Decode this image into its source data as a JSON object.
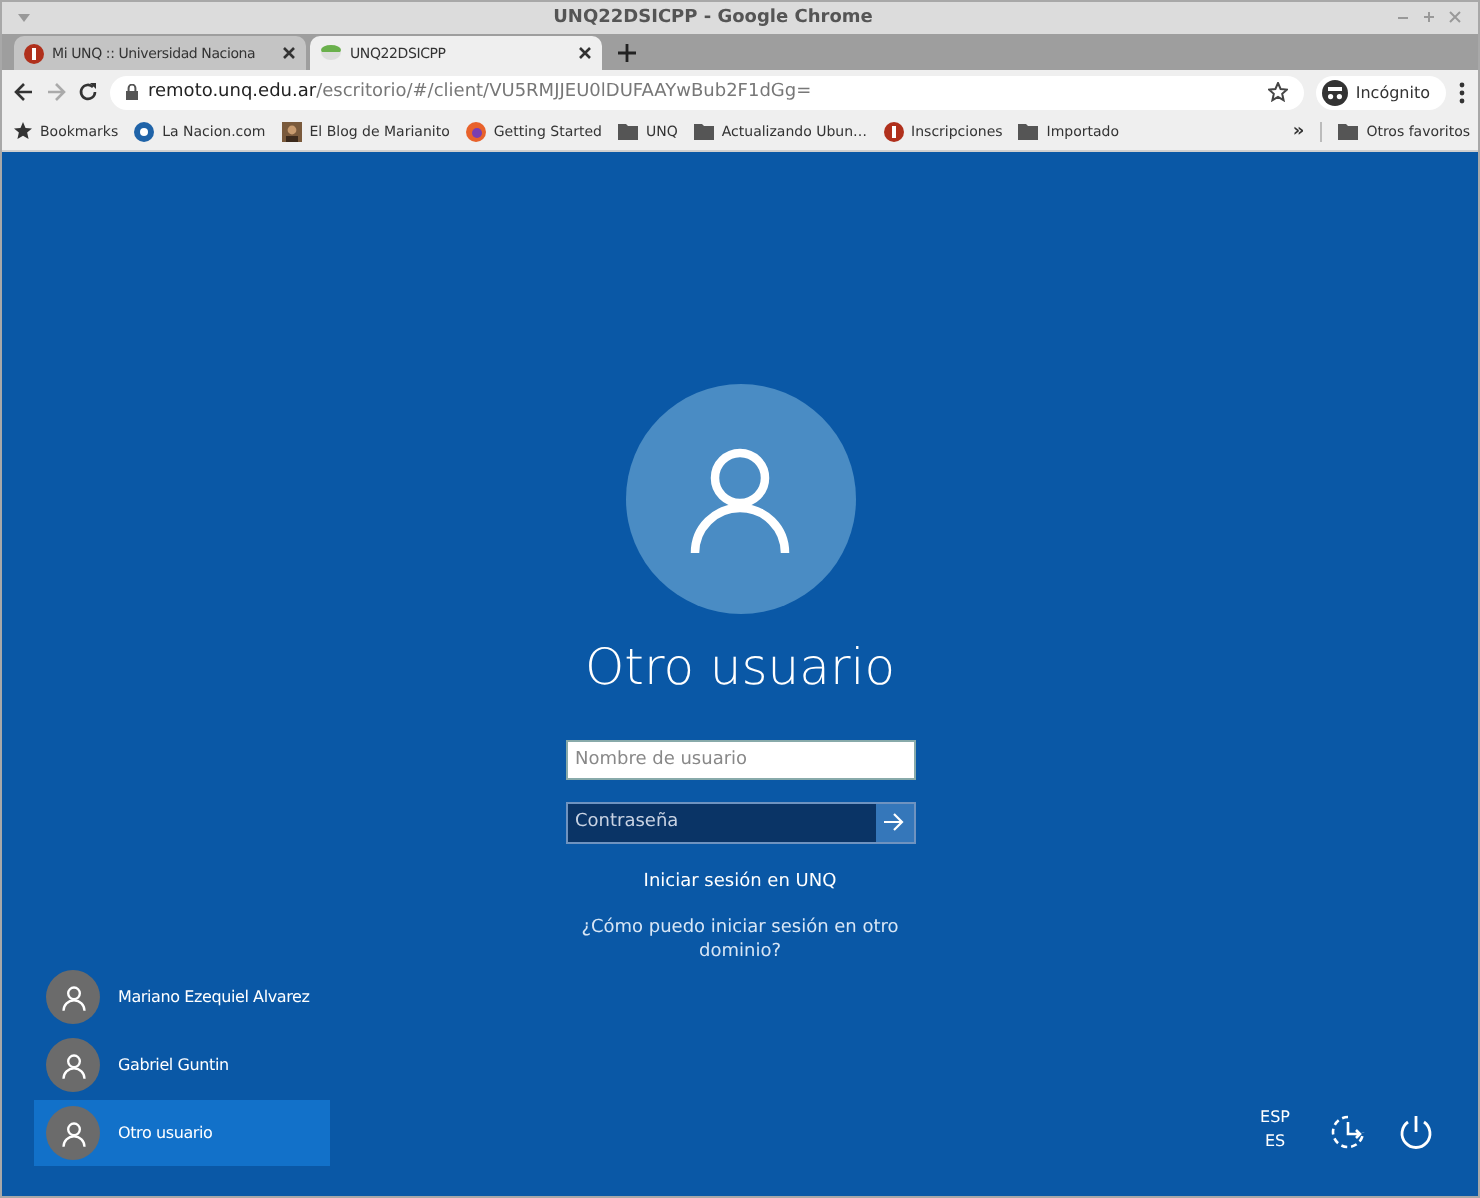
{
  "window": {
    "title": "UNQ22DSICPP - Google Chrome"
  },
  "tabs": [
    {
      "title": "Mi UNQ :: Universidad Naciona",
      "kind": "unq",
      "selected": false
    },
    {
      "title": "UNQ22DSICPP",
      "kind": "remote",
      "selected": true
    }
  ],
  "address_bar": {
    "domain": "remoto.unq.edu.ar",
    "path": "/escritorio/#/client/VU5RMJJEU0lDUFAAYwBub2F1dGg="
  },
  "profile": {
    "label": "Incógnito"
  },
  "bookmarks": [
    {
      "label": "Bookmarks",
      "kind": "star"
    },
    {
      "label": "La Nacion.com",
      "kind": "nacion"
    },
    {
      "label": "El Blog de Marianito",
      "kind": "photo"
    },
    {
      "label": "Getting Started",
      "kind": "firefox"
    },
    {
      "label": "UNQ",
      "kind": "folder"
    },
    {
      "label": "Actualizando Ubun…",
      "kind": "folder"
    },
    {
      "label": "Inscripciones",
      "kind": "unq"
    },
    {
      "label": "Importado",
      "kind": "folder"
    }
  ],
  "bookmarks_overflow": "»",
  "other_bookmarks": "Otros favoritos",
  "login": {
    "user_name": "Otro usuario",
    "username_placeholder": "Nombre de usuario",
    "password_placeholder": "Contraseña",
    "sign_in_to": "Iniciar sesión en UNQ",
    "help_link": "¿Cómo puedo iniciar sesión en otro dominio?"
  },
  "users": [
    {
      "name": "Mariano Ezequiel Alvarez",
      "selected": false
    },
    {
      "name": "Gabriel Guntin",
      "selected": false
    },
    {
      "name": "Otro usuario",
      "selected": true
    }
  ],
  "language": {
    "code": "ESP",
    "layout": "ES"
  }
}
